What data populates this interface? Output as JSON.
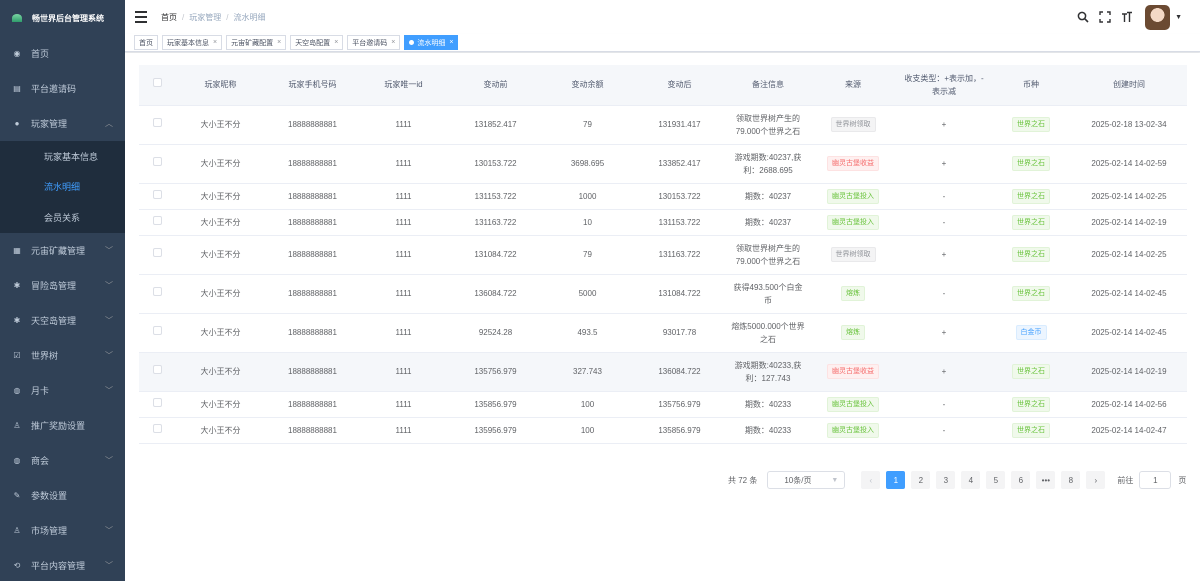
{
  "app": {
    "title": "畅世界后台管理系统"
  },
  "sidebar": {
    "items": [
      {
        "label": "首页",
        "icon": "dashboard-icon"
      },
      {
        "label": "平台邀请码",
        "icon": "document-icon"
      },
      {
        "label": "玩家管理",
        "icon": "user-icon",
        "expanded": true,
        "children": [
          {
            "label": "玩家基本信息",
            "active": false
          },
          {
            "label": "流水明细",
            "active": true
          },
          {
            "label": "会员关系",
            "active": false
          }
        ]
      },
      {
        "label": "元宙矿藏管理",
        "icon": "grid-icon"
      },
      {
        "label": "冒险岛管理",
        "icon": "bug-icon"
      },
      {
        "label": "天空岛管理",
        "icon": "bug-icon"
      },
      {
        "label": "世界树",
        "icon": "checkbox-icon"
      },
      {
        "label": "月卡",
        "icon": "coin-icon"
      },
      {
        "label": "推广奖励设置",
        "icon": "people-icon"
      },
      {
        "label": "商会",
        "icon": "coin-icon"
      },
      {
        "label": "参数设置",
        "icon": "edit-icon"
      },
      {
        "label": "市场管理",
        "icon": "people-icon"
      },
      {
        "label": "平台内容管理",
        "icon": "share-icon"
      }
    ]
  },
  "breadcrumb": [
    "首页",
    "玩家管理",
    "流水明细"
  ],
  "topbar": {
    "icons": [
      "search-icon",
      "fullscreen-icon",
      "font-size-icon"
    ]
  },
  "tags": [
    {
      "label": "首页",
      "active": false,
      "closable": false
    },
    {
      "label": "玩家基本信息",
      "active": false,
      "closable": true
    },
    {
      "label": "元宙矿藏配置",
      "active": false,
      "closable": true
    },
    {
      "label": "天空岛配置",
      "active": false,
      "closable": true
    },
    {
      "label": "平台邀请码",
      "active": false,
      "closable": true
    },
    {
      "label": "流水明细",
      "active": true,
      "closable": true
    }
  ],
  "table": {
    "columns": [
      "玩家昵称",
      "玩家手机号码",
      "玩家唯一id",
      "变动前",
      "变动余额",
      "变动后",
      "备注信息",
      "来源",
      "收支类型：+表示加，-表示减",
      "币种",
      "创建时间"
    ],
    "rows": [
      {
        "nickname": "大小王不分",
        "phone": "18888888881",
        "uid": "1111",
        "before": "131852.417",
        "amount": "79",
        "after": "131931.417",
        "remark": "领取世界树产生的79.000个世界之石",
        "source": "世界树领取",
        "source_type": "info",
        "sign": "+",
        "currency": "世界之石",
        "currency_type": "success",
        "created": "2025-02-18 13-02-34",
        "highlight": false
      },
      {
        "nickname": "大小王不分",
        "phone": "18888888881",
        "uid": "1111",
        "before": "130153.722",
        "amount": "3698.695",
        "after": "133852.417",
        "remark": "游戏期数:40237,获利：2688.695",
        "source": "幽灵古堡收益",
        "source_type": "danger",
        "sign": "+",
        "currency": "世界之石",
        "currency_type": "success",
        "created": "2025-02-14 14-02-59",
        "highlight": false
      },
      {
        "nickname": "大小王不分",
        "phone": "18888888881",
        "uid": "1111",
        "before": "131153.722",
        "amount": "1000",
        "after": "130153.722",
        "remark": "期数：40237",
        "source": "幽灵古堡投入",
        "source_type": "success",
        "sign": "-",
        "currency": "世界之石",
        "currency_type": "success",
        "created": "2025-02-14 14-02-25",
        "highlight": false
      },
      {
        "nickname": "大小王不分",
        "phone": "18888888881",
        "uid": "1111",
        "before": "131163.722",
        "amount": "10",
        "after": "131153.722",
        "remark": "期数：40237",
        "source": "幽灵古堡投入",
        "source_type": "success",
        "sign": "-",
        "currency": "世界之石",
        "currency_type": "success",
        "created": "2025-02-14 14-02-19",
        "highlight": false
      },
      {
        "nickname": "大小王不分",
        "phone": "18888888881",
        "uid": "1111",
        "before": "131084.722",
        "amount": "79",
        "after": "131163.722",
        "remark": "领取世界树产生的79.000个世界之石",
        "source": "世界树领取",
        "source_type": "info",
        "sign": "+",
        "currency": "世界之石",
        "currency_type": "success",
        "created": "2025-02-14 14-02-25",
        "highlight": false
      },
      {
        "nickname": "大小王不分",
        "phone": "18888888881",
        "uid": "1111",
        "before": "136084.722",
        "amount": "5000",
        "after": "131084.722",
        "remark": "获得493.500个白金币",
        "source": "熔炼",
        "source_type": "success",
        "sign": "-",
        "currency": "世界之石",
        "currency_type": "success",
        "created": "2025-02-14 14-02-45",
        "highlight": false
      },
      {
        "nickname": "大小王不分",
        "phone": "18888888881",
        "uid": "1111",
        "before": "92524.28",
        "amount": "493.5",
        "after": "93017.78",
        "remark": "熔炼5000.000个世界之石",
        "source": "熔炼",
        "source_type": "success",
        "sign": "+",
        "currency": "白金币",
        "currency_type": "primary",
        "created": "2025-02-14 14-02-45",
        "highlight": false
      },
      {
        "nickname": "大小王不分",
        "phone": "18888888881",
        "uid": "1111",
        "before": "135756.979",
        "amount": "327.743",
        "after": "136084.722",
        "remark": "游戏期数:40233,获利：127.743",
        "source": "幽灵古堡收益",
        "source_type": "danger",
        "sign": "+",
        "currency": "世界之石",
        "currency_type": "success",
        "created": "2025-02-14 14-02-19",
        "highlight": true
      },
      {
        "nickname": "大小王不分",
        "phone": "18888888881",
        "uid": "1111",
        "before": "135856.979",
        "amount": "100",
        "after": "135756.979",
        "remark": "期数：40233",
        "source": "幽灵古堡投入",
        "source_type": "success",
        "sign": "-",
        "currency": "世界之石",
        "currency_type": "success",
        "created": "2025-02-14 14-02-56",
        "highlight": false
      },
      {
        "nickname": "大小王不分",
        "phone": "18888888881",
        "uid": "1111",
        "before": "135956.979",
        "amount": "100",
        "after": "135856.979",
        "remark": "期数：40233",
        "source": "幽灵古堡投入",
        "source_type": "success",
        "sign": "-",
        "currency": "世界之石",
        "currency_type": "success",
        "created": "2025-02-14 14-02-47",
        "highlight": false
      }
    ]
  },
  "pagination": {
    "total": "共 72 条",
    "page_size": "10条/页",
    "pages": [
      "1",
      "2",
      "3",
      "4",
      "5",
      "6",
      "•••",
      "8"
    ],
    "current": "1",
    "goto_label": "前往",
    "goto_value": "1",
    "page_word": "页"
  }
}
